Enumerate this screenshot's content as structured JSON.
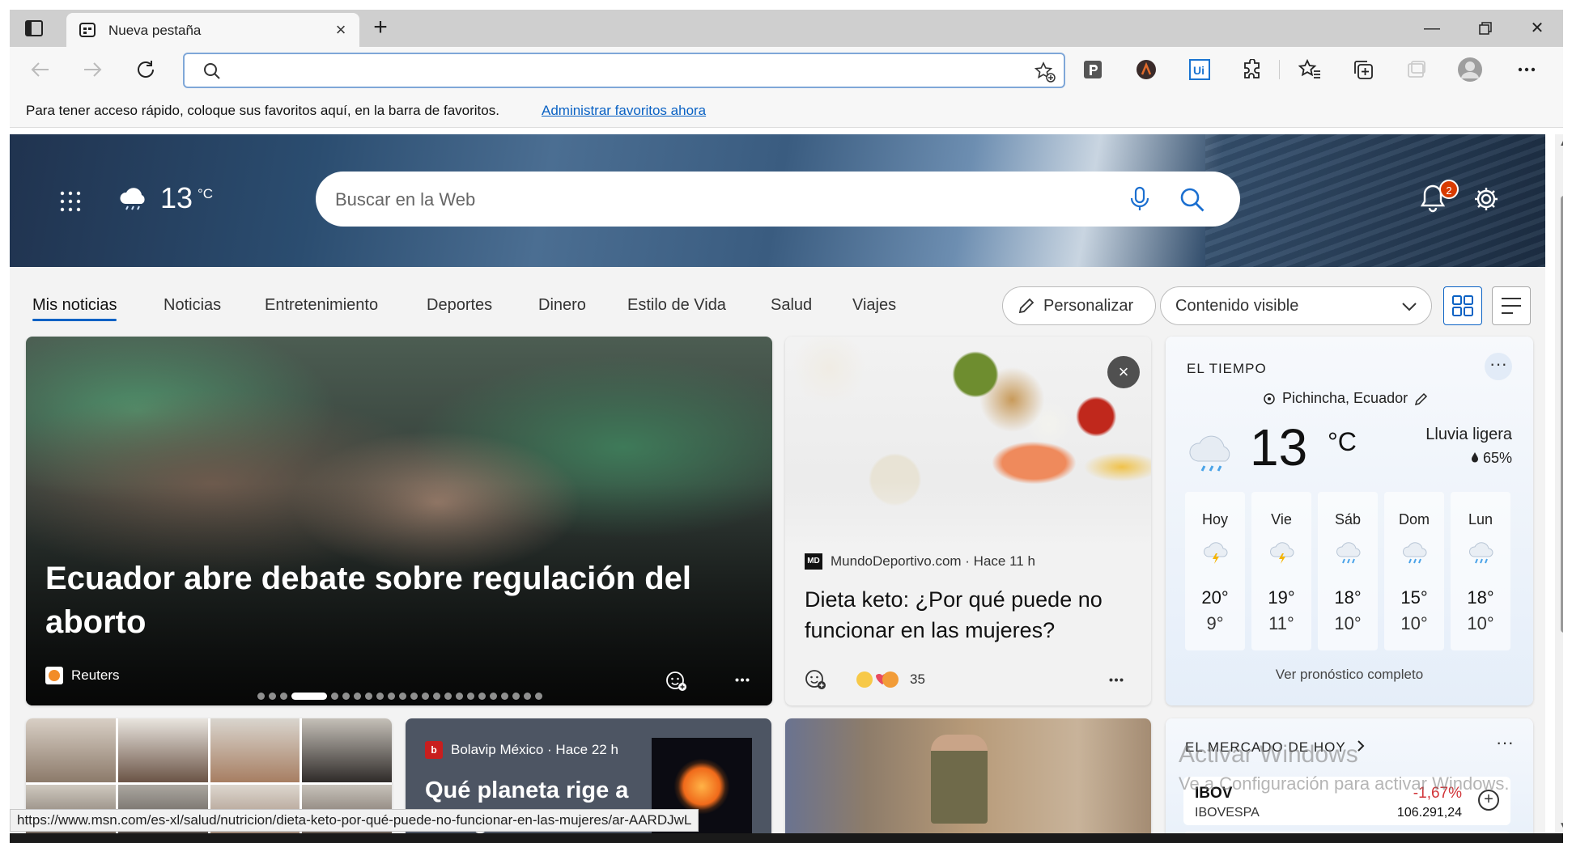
{
  "tab": {
    "title": "Nueva pestaña"
  },
  "address_bar": {
    "value": ""
  },
  "favorites_bar": {
    "message": "Para tener acceso rápido, coloque sus favoritos aquí, en la barra de favoritos.",
    "link": "Administrar favoritos ahora"
  },
  "header": {
    "weather_temp": "13",
    "weather_unit": "°C",
    "search_placeholder": "Buscar en la Web",
    "notification_count": "2"
  },
  "nav": {
    "tabs": [
      "Mis noticias",
      "Noticias",
      "Entretenimiento",
      "Deportes",
      "Dinero",
      "Estilo de Vida",
      "Salud",
      "Viajes"
    ],
    "active_tab": "Mis noticias",
    "personalize": "Personalizar",
    "content_select": "Contenido visible"
  },
  "main_story": {
    "title": "Ecuador abre debate sobre regulación del aborto",
    "source": "Reuters",
    "carousel_count": 23,
    "carousel_active": 3
  },
  "keto_story": {
    "source": "MundoDeportivo.com · Hace 11 h",
    "source_logo": "MD",
    "title": "Dieta keto: ¿Por qué puede no funcionar en las mujeres?",
    "reaction_count": "35"
  },
  "weather": {
    "heading": "EL TIEMPO",
    "location": "Pichincha, Ecuador",
    "temp": "13",
    "unit": "°C",
    "condition": "Lluvia ligera",
    "humidity": "65%",
    "days": [
      {
        "name": "Hoy",
        "hi": "20°",
        "lo": "9°",
        "icon": "thunder-rain"
      },
      {
        "name": "Vie",
        "hi": "19°",
        "lo": "11°",
        "icon": "thunder-rain"
      },
      {
        "name": "Sáb",
        "hi": "18°",
        "lo": "10°",
        "icon": "rain"
      },
      {
        "name": "Dom",
        "hi": "15°",
        "lo": "10°",
        "icon": "rain"
      },
      {
        "name": "Lun",
        "hi": "18°",
        "lo": "10°",
        "icon": "rain"
      }
    ],
    "full_forecast": "Ver pronóstico completo"
  },
  "planet_story": {
    "source": "Bolavip México · Hace 22 h",
    "title": "Qué planeta rige a tu signo del"
  },
  "market": {
    "heading": "EL MERCADO DE HOY",
    "symbol": "IBOV",
    "name": "IBOVESPA",
    "change": "-1,67%",
    "value": "106.291,24"
  },
  "watermark": {
    "title": "Activar Windows",
    "subtitle": "Ve a Configuración para activar Windows."
  },
  "status_url": "https://www.msn.com/es-xl/salud/nutricion/dieta-keto-por-qué-puede-no-funcionar-en-las-mujeres/ar-AARDJwL",
  "colors": {
    "accent": "#0a62c4",
    "badge": "#d83b01",
    "negative": "#d13438"
  }
}
